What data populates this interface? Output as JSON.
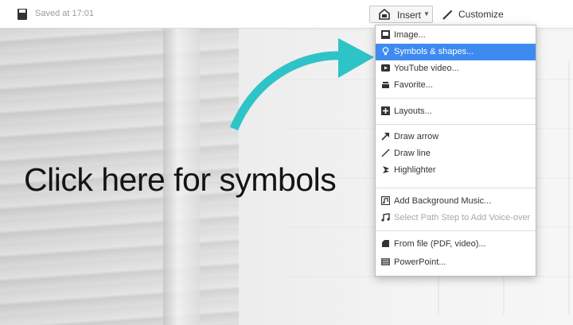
{
  "toolbar": {
    "saved_text": "Saved at 17:01",
    "insert_label": "Insert",
    "customize_label": "Customize"
  },
  "canvas": {
    "headline": "Click here for symbols",
    "arrow_color": "#2ec4c7"
  },
  "menu": {
    "highlight_color": "#3d8bf0",
    "items": [
      {
        "label": "Image...",
        "icon": "image-icon"
      },
      {
        "label": "Symbols & shapes...",
        "icon": "lightbulb-icon",
        "state": "highlighted"
      },
      {
        "label": "YouTube video...",
        "icon": "youtube-icon"
      },
      {
        "label": "Favorite...",
        "icon": "favorite-icon"
      },
      {
        "label": "Layouts...",
        "icon": "layouts-icon"
      },
      {
        "label": "Draw arrow",
        "icon": "arrow-icon"
      },
      {
        "label": "Draw line",
        "icon": "line-icon"
      },
      {
        "label": "Highlighter",
        "icon": "highlighter-icon"
      },
      {
        "label": "Add Background Music...",
        "icon": "music-doc-icon"
      },
      {
        "label": "Select Path Step to Add Voice-over",
        "icon": "music-note-icon",
        "state": "disabled"
      },
      {
        "label": "From file (PDF, video)...",
        "icon": "file-icon"
      },
      {
        "label": "PowerPoint...",
        "icon": "powerpoint-icon"
      }
    ]
  }
}
